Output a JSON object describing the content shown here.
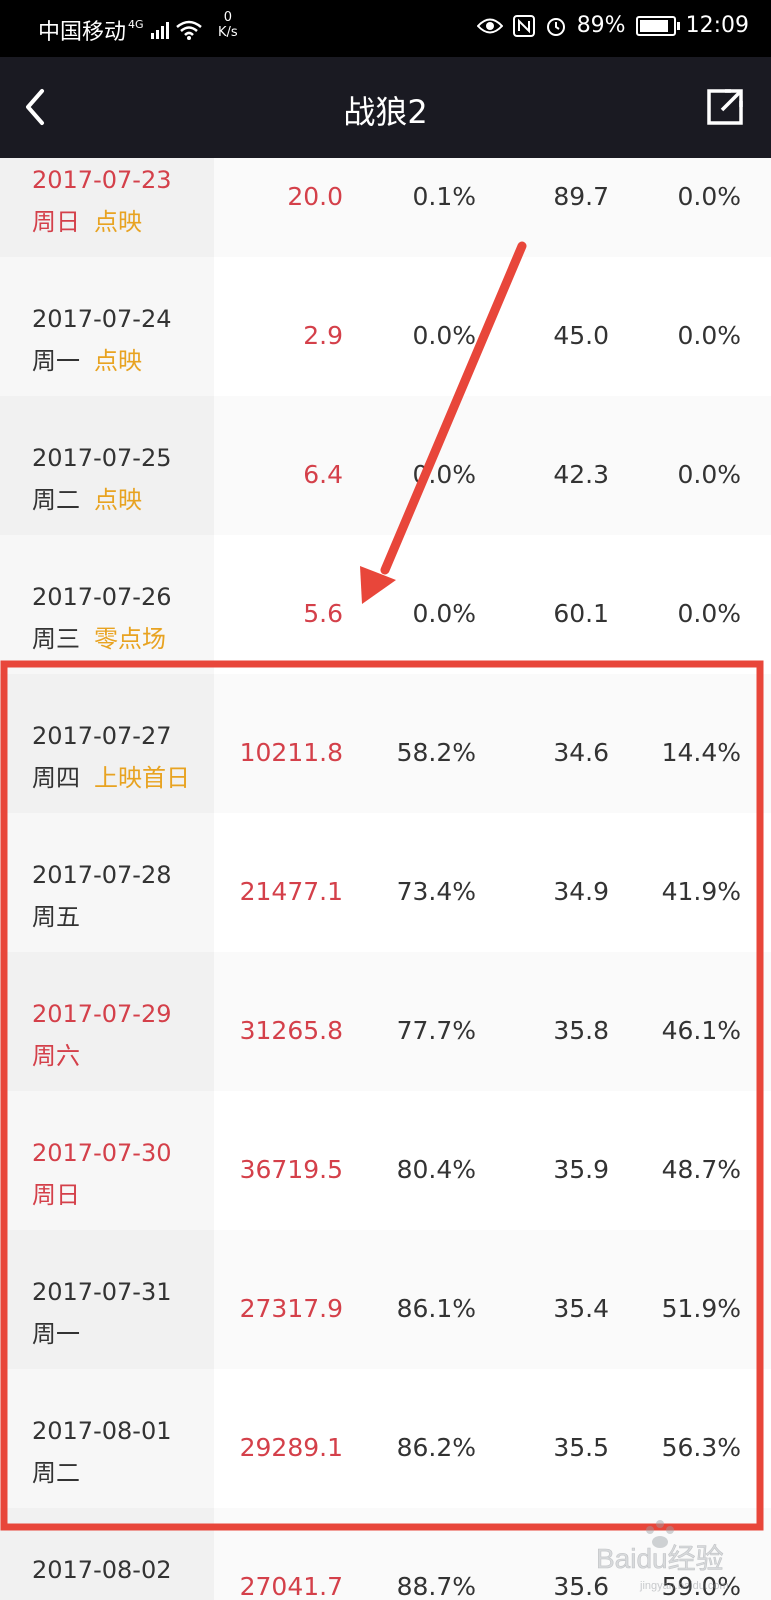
{
  "status_bar": {
    "carrier": "中国移动",
    "network": "4G",
    "speed_value": "0",
    "speed_unit": "K/s",
    "battery": "89%",
    "time": "12:09"
  },
  "header": {
    "title": "战狼2"
  },
  "rows": [
    {
      "date": "2017-07-23",
      "weekday": "周日",
      "tag": "点映",
      "box_office": "20.0",
      "share": "0.1%",
      "avg_price": "89.7",
      "screening": "0.0%",
      "weekend": true
    },
    {
      "date": "2017-07-24",
      "weekday": "周一",
      "tag": "点映",
      "box_office": "2.9",
      "share": "0.0%",
      "avg_price": "45.0",
      "screening": "0.0%",
      "weekend": false
    },
    {
      "date": "2017-07-25",
      "weekday": "周二",
      "tag": "点映",
      "box_office": "6.4",
      "share": "0.0%",
      "avg_price": "42.3",
      "screening": "0.0%",
      "weekend": false
    },
    {
      "date": "2017-07-26",
      "weekday": "周三",
      "tag": "零点场",
      "box_office": "5.6",
      "share": "0.0%",
      "avg_price": "60.1",
      "screening": "0.0%",
      "weekend": false
    },
    {
      "date": "2017-07-27",
      "weekday": "周四",
      "tag": "上映首日",
      "box_office": "10211.8",
      "share": "58.2%",
      "avg_price": "34.6",
      "screening": "14.4%",
      "weekend": false
    },
    {
      "date": "2017-07-28",
      "weekday": "周五",
      "tag": "",
      "box_office": "21477.1",
      "share": "73.4%",
      "avg_price": "34.9",
      "screening": "41.9%",
      "weekend": false
    },
    {
      "date": "2017-07-29",
      "weekday": "周六",
      "tag": "",
      "box_office": "31265.8",
      "share": "77.7%",
      "avg_price": "35.8",
      "screening": "46.1%",
      "weekend": true
    },
    {
      "date": "2017-07-30",
      "weekday": "周日",
      "tag": "",
      "box_office": "36719.5",
      "share": "80.4%",
      "avg_price": "35.9",
      "screening": "48.7%",
      "weekend": true
    },
    {
      "date": "2017-07-31",
      "weekday": "周一",
      "tag": "",
      "box_office": "27317.9",
      "share": "86.1%",
      "avg_price": "35.4",
      "screening": "51.9%",
      "weekend": false
    },
    {
      "date": "2017-08-01",
      "weekday": "周二",
      "tag": "",
      "box_office": "29289.1",
      "share": "86.2%",
      "avg_price": "35.5",
      "screening": "56.3%",
      "weekend": false
    },
    {
      "date": "2017-08-02",
      "weekday": "",
      "tag": "",
      "box_office": "27041.7",
      "share": "88.7%",
      "avg_price": "35.6",
      "screening": "59.0%",
      "weekend": false
    }
  ],
  "watermark": {
    "text": "Baidu经验",
    "url": "jingyan.baidu.com"
  },
  "colors": {
    "highlight_red": "#d4404a",
    "tag_orange": "#e8a321",
    "annotation_red": "#e8463a"
  }
}
